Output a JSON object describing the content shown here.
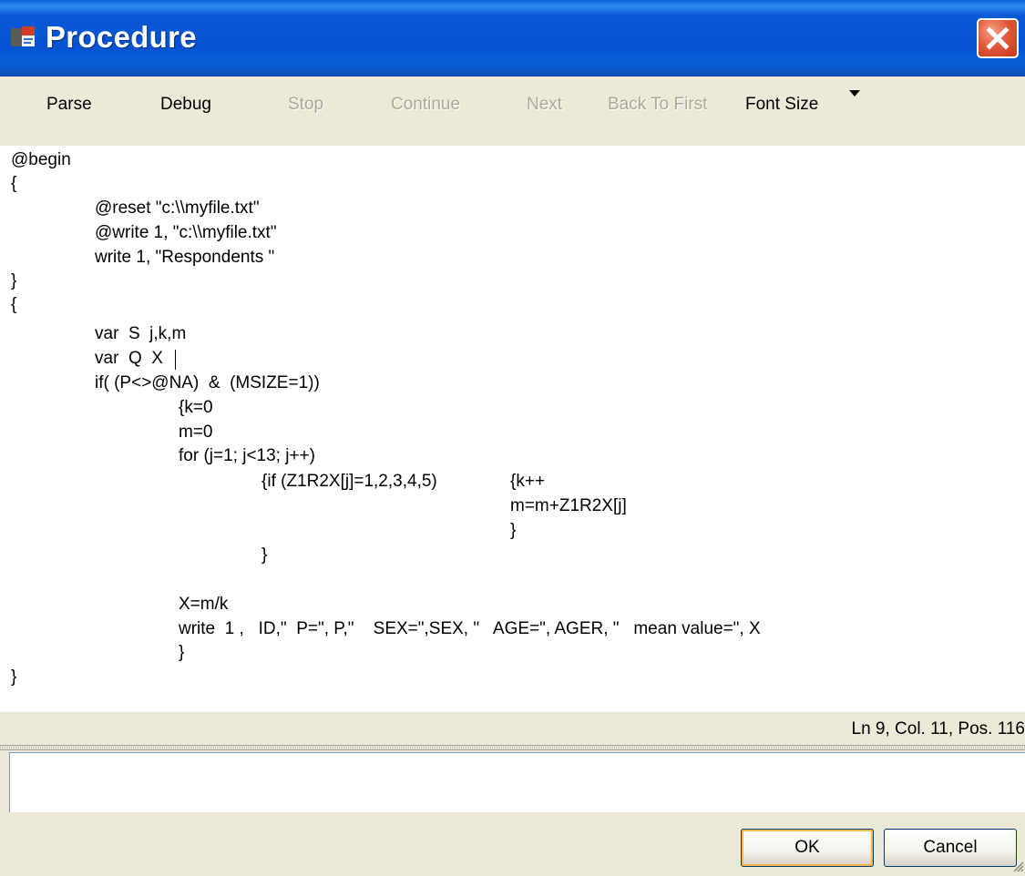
{
  "window": {
    "title": "Procedure",
    "app_icon": "procedure-app-icon",
    "close_icon": "close-icon",
    "colors": {
      "titlebar": "#0453d2",
      "close": "#e2593b",
      "face": "#ece9d8"
    }
  },
  "toolbar": {
    "items": [
      {
        "label": "Parse",
        "enabled": true
      },
      {
        "label": "Debug",
        "enabled": true
      },
      {
        "label": "Stop",
        "enabled": false
      },
      {
        "label": "Continue",
        "enabled": false
      },
      {
        "label": "Next",
        "enabled": false
      },
      {
        "label": "Back To First",
        "enabled": false
      },
      {
        "label": "Font Size",
        "enabled": true
      }
    ],
    "font_size_dropdown_icon": "chevron-down-icon"
  },
  "editor": {
    "lines": [
      "@begin",
      "{",
      "@reset \"c:\\\\myfile.txt\"",
      "@write 1, \"c:\\\\myfile.txt\"",
      "write 1, \"Respondents \"",
      "}",
      "{",
      "var  S  j,k,m",
      "var  Q  X",
      "if( (P<>@NA)  &  (MSIZE=1))",
      "{k=0",
      "m=0",
      "for (j=1; j<13; j++)",
      "{if (Z1R2X[j]=1,2,3,4,5)",
      "{k++",
      "m=m+Z1R2X[j]",
      "}",
      "}",
      "X=m/k",
      "write  1 ,   ID,\"  P=\", P,\"    SEX=\",SEX, \"   AGE=\", AGER, \"   mean value=\", X",
      "}",
      "}"
    ]
  },
  "status": {
    "position": "Ln 9, Col. 11, Pos. 116"
  },
  "output": {
    "value": ""
  },
  "buttons": {
    "ok": "OK",
    "cancel": "Cancel"
  }
}
